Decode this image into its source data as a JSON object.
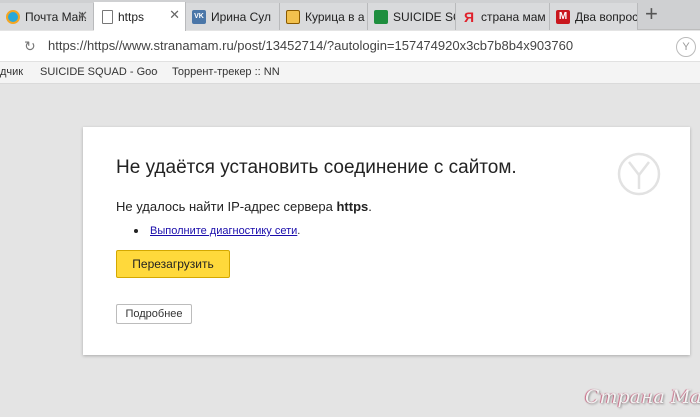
{
  "tabs": [
    {
      "label": "Почта Mail.",
      "icon": "mail-ru-icon"
    },
    {
      "label": "https",
      "icon": "page-icon"
    },
    {
      "label": "Ирина Сул",
      "icon": "vk-icon"
    },
    {
      "label": "Курица в а",
      "icon": "bookmark-site-icon"
    },
    {
      "label": "SUICIDE SQ",
      "icon": "sheets-icon"
    },
    {
      "label": "страна мам",
      "icon": "yandex-icon"
    },
    {
      "label": "Два вопрос",
      "icon": "m-icon"
    }
  ],
  "address_bar": {
    "url": "https://https//www.stranamam.ru/post/13452714/?autologin=157474920x3cb7b8b4x903760"
  },
  "bookmarks": [
    "дчик",
    "SUICIDE SQUAD - Goog",
    "Торрент-трекер :: NNM"
  ],
  "error": {
    "title": "Не удаётся установить соединение с сайтом.",
    "description_prefix": "Не удалось найти IP-адрес сервера ",
    "host": "https",
    "description_suffix": ".",
    "suggestion_link": "Выполните диагностику сети",
    "suggestion_suffix": ".",
    "reload_label": "Перезагрузить",
    "details_label": "Подробнее"
  },
  "watermark": "Страна Мам",
  "colors": {
    "reload_button": "#ffd93b",
    "link": "#1a0dab",
    "background": "#e4e4e4"
  }
}
